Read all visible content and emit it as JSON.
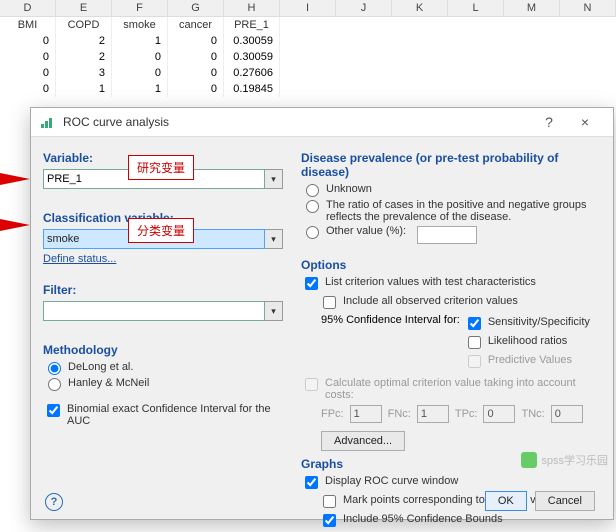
{
  "columns": [
    "D",
    "E",
    "F",
    "G",
    "H",
    "I",
    "J",
    "K",
    "L",
    "M",
    "N"
  ],
  "headers": [
    "BMI",
    "COPD",
    "smoke",
    "cancer",
    "PRE_1"
  ],
  "rows": [
    [
      "0",
      "2",
      "1",
      "0",
      "0.30059"
    ],
    [
      "0",
      "2",
      "0",
      "0",
      "0.30059"
    ],
    [
      "0",
      "3",
      "0",
      "0",
      "0.27606"
    ],
    [
      "0",
      "1",
      "1",
      "0",
      "0.19845"
    ]
  ],
  "dialog": {
    "title": "ROC curve analysis",
    "help": "?",
    "close": "×",
    "left": {
      "variable_label": "Variable:",
      "variable_value": "PRE_1",
      "variable_callout": "研究变量",
      "class_label": "Classification variable:",
      "class_value": "smoke",
      "class_callout": "分类变量",
      "define_status": "Define status...",
      "filter_label": "Filter:",
      "filter_value": "",
      "method_label": "Methodology",
      "method_delong": "DeLong et al.",
      "method_hanley": "Hanley & McNeil",
      "binomial": "Binomial exact Confidence Interval for the AUC"
    },
    "right": {
      "prev_label": "Disease prevalence (or pre-test probability of disease)",
      "unknown": "Unknown",
      "ratio": "The ratio of cases in the positive and negative groups reflects the prevalence of the disease.",
      "other": "Other value (%):",
      "other_value": "",
      "options_label": "Options",
      "list_crit": "List criterion values with test characteristics",
      "include_all": "Include all observed criterion values",
      "ci_label": "95% Confidence Interval for:",
      "ci_sens": "Sensitivity/Specificity",
      "ci_lr": "Likelihood ratios",
      "ci_pv": "Predictive Values",
      "calc_opt": "Calculate optimal criterion value taking into account costs:",
      "fpc_l": "FPc:",
      "fpc": "1",
      "fnc_l": "FNc:",
      "fnc": "1",
      "tpc_l": "TPc:",
      "tpc": "0",
      "tnc_l": "TNc:",
      "tnc": "0",
      "advanced": "Advanced...",
      "graphs_label": "Graphs",
      "disp_roc": "Display ROC curve window",
      "mark_pts": "Mark points corresponding to criterion values",
      "inc_95": "Include 95% Confidence Bounds"
    },
    "ok": "OK",
    "cancel": "Cancel"
  },
  "watermark": "spss学习乐园"
}
